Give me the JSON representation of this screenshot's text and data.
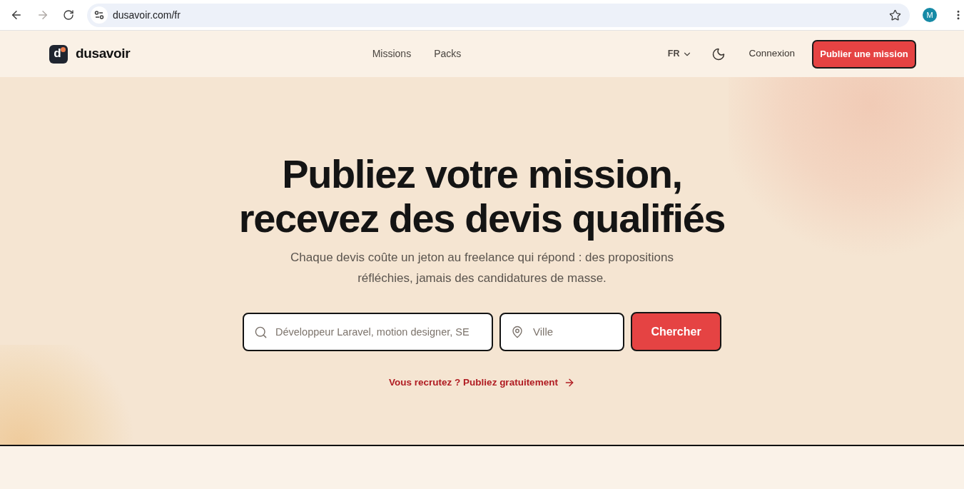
{
  "browser": {
    "nav_buttons": [
      {
        "kind": "back",
        "disabled": false
      },
      {
        "kind": "forward",
        "disabled": true
      },
      {
        "kind": "reload",
        "disabled": false
      }
    ],
    "url": "dusavoir.com/fr",
    "profile_initial": "M"
  },
  "header": {
    "logo": {
      "letter": "d",
      "name": "dusavoir"
    },
    "nav": [
      "Missions",
      "Packs"
    ],
    "language": "FR",
    "login": "Connexion",
    "cta": "Publier une mission"
  },
  "hero": {
    "title_lines": [
      "Publiez votre mission,",
      "recevez des devis qualifiés"
    ],
    "subtitle": "Chaque devis coûte un jeton au freelance qui répond : des propositions réfléchies, jamais des candidatures de masse.",
    "search": {
      "query_placeholder": "Développeur Laravel, motion designer, SE",
      "city_placeholder": "Ville",
      "button": "Chercher"
    },
    "recruit_link": "Vous recrutez ? Publiez gratuitement"
  }
}
